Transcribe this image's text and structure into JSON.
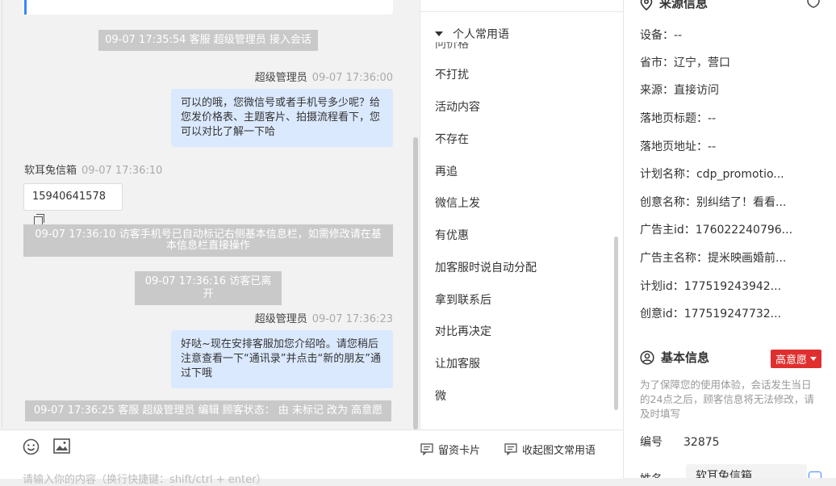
{
  "chat": {
    "messages": {
      "sys1": "09-07 17:35:54 客服 超级管理员 接入会话",
      "sender1_name": "超级管理员",
      "sender1_time": "09-07 17:36:00",
      "msg1": "可以的哦，您微信号或者手机号多少呢？给您发价格表、主题客片、拍摄流程看下，您可以对比了解一下哈",
      "visitor_name": "软耳兔信箱",
      "visitor_time": "09-07 17:36:10",
      "visitor_msg": "15940641578",
      "sys2": "09-07 17:36:10 访客手机号已自动标记右侧基本信息栏，如需修改请在基本信息栏直接操作",
      "sys3": "09-07 17:36:16 访客已离开",
      "sender2_name": "超级管理员",
      "sender2_time": "09-07 17:36:23",
      "msg2": "好哒~现在安排客服加您介绍哈。请您稍后注意查看一下“通讯录”并点击“新的朋友”通过下哦",
      "sys4": "09-07 17:36:25 客服 超级管理员 编辑 顾客状态： 由 未标记 改为 高意愿"
    },
    "toolbar": {
      "emoji_icon": "emoji-icon",
      "image_icon": "image-icon",
      "lead_card_label": "留资卡片",
      "collapse_phrases_label": "收起图文常用语"
    },
    "input": {
      "placeholder": "请输入你的内容（换行快捷键：shift/ctrl + enter）"
    }
  },
  "phrases": {
    "header": "个人常用语",
    "partial_top": "问价格",
    "items": [
      "不打扰",
      "活动内容",
      "不存在",
      "再追",
      "微信上发",
      "有优惠",
      "加客服时说自动分配",
      "拿到联系后",
      "对比再决定",
      "让加客服",
      "微"
    ]
  },
  "info": {
    "source_title": "来源信息",
    "source_rows": [
      "设备：--",
      "省市：辽宁，营口",
      "来源：直接访问",
      "落地页标题：--",
      "落地页地址：--",
      "计划名称：cdp_promotio...",
      "创意名称：别纠结了！看看...",
      "广告主id：176022240796...",
      "广告主名称：提米映画婚前...",
      "计划id：177519243942...",
      "创意id：177519247732..."
    ],
    "basic_title": "基本信息",
    "intent_badge": "高意愿",
    "notice": "为了保障您的使用体验，会话发生当日的24点之后，顾客信息将无法修改，请及时填写",
    "id_label": "编号",
    "id_value": "32875",
    "name_label": "姓名",
    "name_value": "软耳兔信箱"
  },
  "colors": {
    "accent": "#3a86ff",
    "bubble_right": "#dbe9ff",
    "system_msg": "#c9c9c9",
    "badge": "#e02f2f"
  }
}
